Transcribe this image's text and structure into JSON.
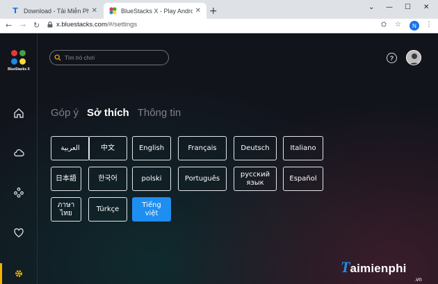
{
  "browser": {
    "tabs": [
      {
        "favicon": "T",
        "title": "Download - Tải Miễn Phí VN - Ph",
        "active": false
      },
      {
        "favicon": "bluestacks-logo",
        "title": "BlueStacks X - Play Android gam",
        "active": true
      }
    ],
    "new_tab": "+",
    "window_controls": {
      "minimize": "—",
      "maximize": "☐",
      "close": "✕"
    },
    "address": {
      "host": "x.bluestacks.com",
      "path": "/#/settings"
    },
    "profile_initial": "N"
  },
  "app": {
    "logo_text": "BlueStacks X",
    "search": {
      "placeholder": "Tìm trò chơi"
    },
    "sidebar": [
      {
        "icon": "home-icon"
      },
      {
        "icon": "cloud-icon"
      },
      {
        "icon": "apps-icon"
      },
      {
        "icon": "heart-icon"
      },
      {
        "icon": "gear-icon",
        "active": true
      }
    ],
    "help_label": "?",
    "settings": {
      "tabs": [
        {
          "label": "Góp ý",
          "active": false
        },
        {
          "label": "Sở thích",
          "active": true
        },
        {
          "label": "Thông tin",
          "active": false
        }
      ],
      "languages": [
        {
          "label": "العربية",
          "selected": false
        },
        {
          "label": "中文",
          "selected": false
        },
        {
          "label": "English",
          "selected": false
        },
        {
          "label": "Français",
          "selected": false
        },
        {
          "label": "Deutsch",
          "selected": false
        },
        {
          "label": "Italiano",
          "selected": false
        },
        {
          "label": "日本語",
          "selected": false
        },
        {
          "label": "한국어",
          "selected": false
        },
        {
          "label": "polski",
          "selected": false
        },
        {
          "label": "Português",
          "selected": false
        },
        {
          "label": "русский язык",
          "selected": false
        },
        {
          "label": "Español",
          "selected": false
        },
        {
          "label": "ภาษาไทย",
          "selected": false
        },
        {
          "label": "Türkçe",
          "selected": false
        },
        {
          "label": "Tiếng việt",
          "selected": true
        }
      ]
    }
  },
  "watermark": {
    "initial": "T",
    "text": "aimienphi",
    "suffix": ".vn"
  },
  "colors": {
    "accent": "#1f8ef1",
    "active_nav": "#f5b301",
    "background": "#12141c"
  }
}
